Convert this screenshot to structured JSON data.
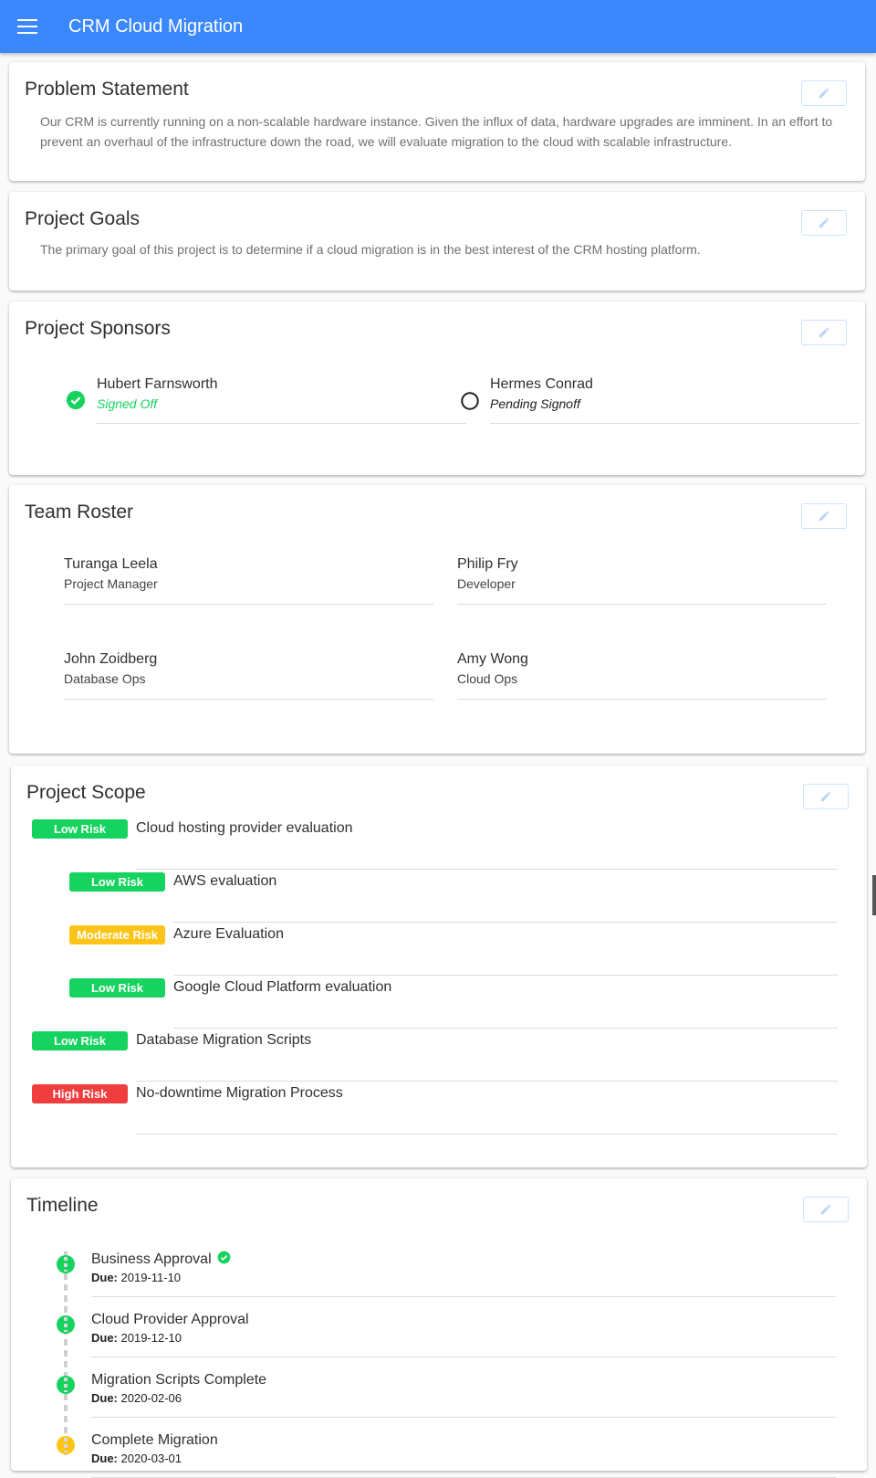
{
  "app": {
    "title": "CRM Cloud Migration",
    "menu_icon": "hamburger-menu-icon"
  },
  "colors": {
    "primary": "#3b88fd",
    "low_risk": "#16d35f",
    "moderate_risk": "#fcc419",
    "high_risk": "#f03e3e",
    "signed_off": "#16d35f"
  },
  "problem_statement": {
    "title": "Problem Statement",
    "text": "Our CRM is currently running on a non-scalable hardware instance. Given the influx of data, hardware upgrades are imminent. In an effort to prevent an overhaul of the infrastructure down the road, we will evaluate migration to the cloud with scalable infrastructure."
  },
  "project_goals": {
    "title": "Project Goals",
    "text": "The primary goal of this project is to determine if a cloud migration is in the best interest of the CRM hosting platform."
  },
  "sponsors": {
    "title": "Project Sponsors",
    "items": [
      {
        "name": "Hubert Farnsworth",
        "status": "Signed Off",
        "signed": true
      },
      {
        "name": "Hermes Conrad",
        "status": "Pending Signoff",
        "signed": false
      }
    ]
  },
  "roster": {
    "title": "Team Roster",
    "members": [
      {
        "name": "Turanga Leela",
        "role": "Project Manager"
      },
      {
        "name": "Philip Fry",
        "role": "Developer"
      },
      {
        "name": "John Zoidberg",
        "role": "Database Ops"
      },
      {
        "name": "Amy Wong",
        "role": "Cloud Ops"
      }
    ]
  },
  "scope": {
    "title": "Project Scope",
    "items": [
      {
        "risk": "Low Risk",
        "level": "low",
        "label": "Cloud hosting provider evaluation",
        "indent": 0
      },
      {
        "risk": "Low Risk",
        "level": "low",
        "label": "AWS evaluation",
        "indent": 1
      },
      {
        "risk": "Moderate Risk",
        "level": "moderate",
        "label": "Azure Evaluation",
        "indent": 1
      },
      {
        "risk": "Low Risk",
        "level": "low",
        "label": "Google Cloud Platform evaluation",
        "indent": 1
      },
      {
        "risk": "Low Risk",
        "level": "low",
        "label": "Database Migration Scripts",
        "indent": 0
      },
      {
        "risk": "High Risk",
        "level": "high",
        "label": "No-downtime Migration Process",
        "indent": 0
      }
    ]
  },
  "timeline": {
    "title": "Timeline",
    "due_label": "Due:",
    "items": [
      {
        "title": "Business Approval",
        "due": "2019-11-10",
        "status": "complete",
        "approved": true
      },
      {
        "title": "Cloud Provider Approval",
        "due": "2019-12-10",
        "status": "complete",
        "approved": false
      },
      {
        "title": "Migration Scripts Complete",
        "due": "2020-02-06",
        "status": "complete",
        "approved": false
      },
      {
        "title": "Complete Migration",
        "due": "2020-03-01",
        "status": "in-progress",
        "approved": false
      }
    ]
  }
}
